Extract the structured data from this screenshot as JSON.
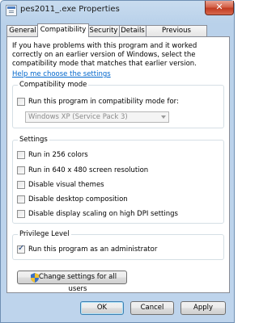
{
  "window": {
    "title": "pes2011_.exe Properties",
    "close_glyph": "✕"
  },
  "tabs": [
    {
      "label": "General"
    },
    {
      "label": "Compatibility"
    },
    {
      "label": "Security"
    },
    {
      "label": "Details"
    },
    {
      "label": "Previous Versions"
    }
  ],
  "active_tab": "Compatibility",
  "intro_text": "If you have problems with this program and it worked correctly on an earlier version of Windows, select the compatibility mode that matches that earlier version.",
  "help_link": "Help me choose the settings",
  "compat_mode": {
    "title": "Compatibility mode",
    "checkbox_label": "Run this program in compatibility mode for:",
    "checked": false,
    "selected_os": "Windows XP (Service Pack 3)"
  },
  "settings": {
    "title": "Settings",
    "items": [
      {
        "label": "Run in 256 colors",
        "checked": false
      },
      {
        "label": "Run in 640 x 480 screen resolution",
        "checked": false
      },
      {
        "label": "Disable visual themes",
        "checked": false
      },
      {
        "label": "Disable desktop composition",
        "checked": false
      },
      {
        "label": "Disable display scaling on high DPI settings",
        "checked": false
      }
    ]
  },
  "privilege": {
    "title": "Privilege Level",
    "checkbox_label": "Run this program as an administrator",
    "checked": true
  },
  "change_settings_button": "Change settings for all users",
  "buttons": {
    "ok": "OK",
    "cancel": "Cancel",
    "apply": "Apply"
  },
  "icons": {
    "app": "application-icon",
    "shield": "uac-shield-icon"
  },
  "colors": {
    "link": "#0066cc",
    "close_button": "#c23c22",
    "frame": "#b9d1ea"
  }
}
